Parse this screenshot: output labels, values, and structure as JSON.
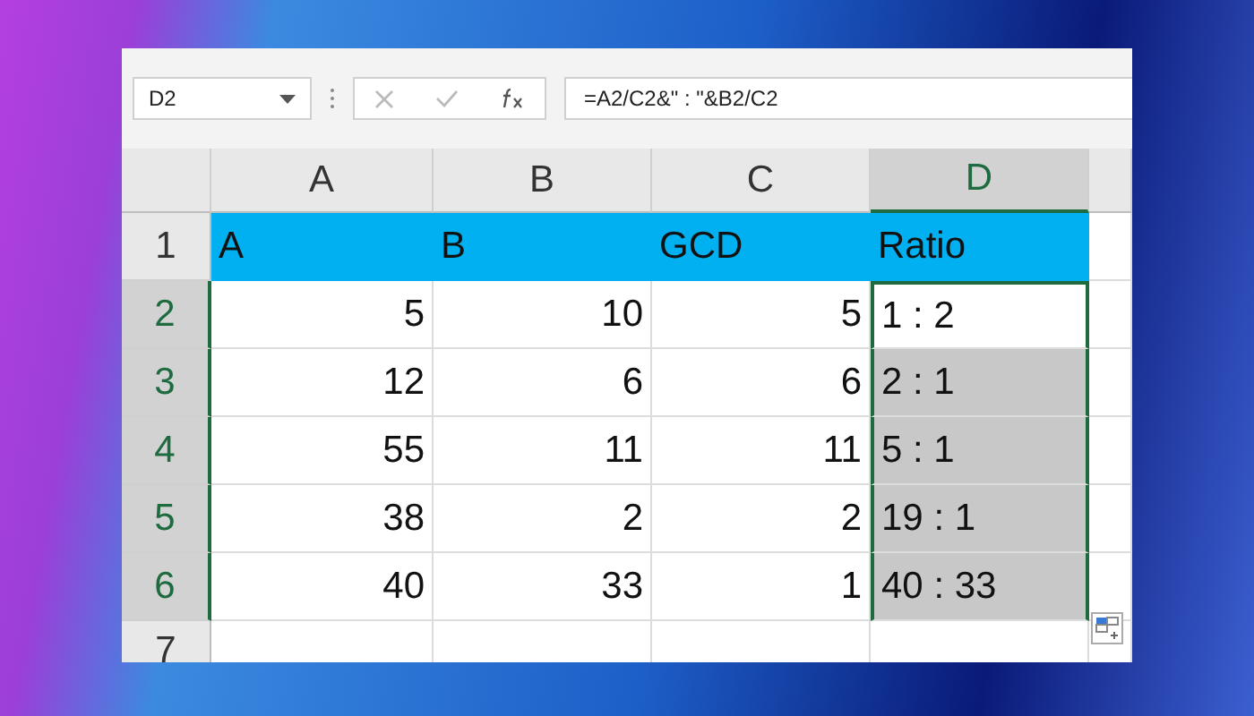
{
  "name_box": {
    "value": "D2"
  },
  "formula_bar": {
    "value": "=A2/C2&\" : \"&B2/C2"
  },
  "columns": [
    {
      "label": "A",
      "selected": false
    },
    {
      "label": "B",
      "selected": false
    },
    {
      "label": "C",
      "selected": false
    },
    {
      "label": "D",
      "selected": true
    }
  ],
  "rows": [
    {
      "number": "1",
      "selected": false,
      "cells": [
        {
          "text": "A",
          "kind": "header",
          "selected": false,
          "active": false
        },
        {
          "text": "B",
          "kind": "header",
          "selected": false,
          "active": false
        },
        {
          "text": "GCD",
          "kind": "header",
          "selected": false,
          "active": false
        },
        {
          "text": "Ratio",
          "kind": "header",
          "selected": false,
          "active": false
        }
      ]
    },
    {
      "number": "2",
      "selected": true,
      "cells": [
        {
          "text": "5",
          "kind": "number",
          "selected": false,
          "active": false
        },
        {
          "text": "10",
          "kind": "number",
          "selected": false,
          "active": false
        },
        {
          "text": "5",
          "kind": "number",
          "selected": false,
          "active": false
        },
        {
          "text": "1 : 2",
          "kind": "text",
          "selected": true,
          "active": true
        }
      ]
    },
    {
      "number": "3",
      "selected": true,
      "cells": [
        {
          "text": "12",
          "kind": "number",
          "selected": false,
          "active": false
        },
        {
          "text": "6",
          "kind": "number",
          "selected": false,
          "active": false
        },
        {
          "text": "6",
          "kind": "number",
          "selected": false,
          "active": false
        },
        {
          "text": "2 : 1",
          "kind": "text",
          "selected": true,
          "active": false
        }
      ]
    },
    {
      "number": "4",
      "selected": true,
      "cells": [
        {
          "text": "55",
          "kind": "number",
          "selected": false,
          "active": false
        },
        {
          "text": "11",
          "kind": "number",
          "selected": false,
          "active": false
        },
        {
          "text": "11",
          "kind": "number",
          "selected": false,
          "active": false
        },
        {
          "text": "5 : 1",
          "kind": "text",
          "selected": true,
          "active": false
        }
      ]
    },
    {
      "number": "5",
      "selected": true,
      "cells": [
        {
          "text": "38",
          "kind": "number",
          "selected": false,
          "active": false
        },
        {
          "text": "2",
          "kind": "number",
          "selected": false,
          "active": false
        },
        {
          "text": "2",
          "kind": "number",
          "selected": false,
          "active": false
        },
        {
          "text": "19 : 1",
          "kind": "text",
          "selected": true,
          "active": false
        }
      ]
    },
    {
      "number": "6",
      "selected": true,
      "cells": [
        {
          "text": "40",
          "kind": "number",
          "selected": false,
          "active": false
        },
        {
          "text": "33",
          "kind": "number",
          "selected": false,
          "active": false
        },
        {
          "text": "1",
          "kind": "number",
          "selected": false,
          "active": false
        },
        {
          "text": "40 : 33",
          "kind": "text",
          "selected": true,
          "active": false
        }
      ]
    },
    {
      "number": "7",
      "selected": false,
      "cells": []
    }
  ]
}
